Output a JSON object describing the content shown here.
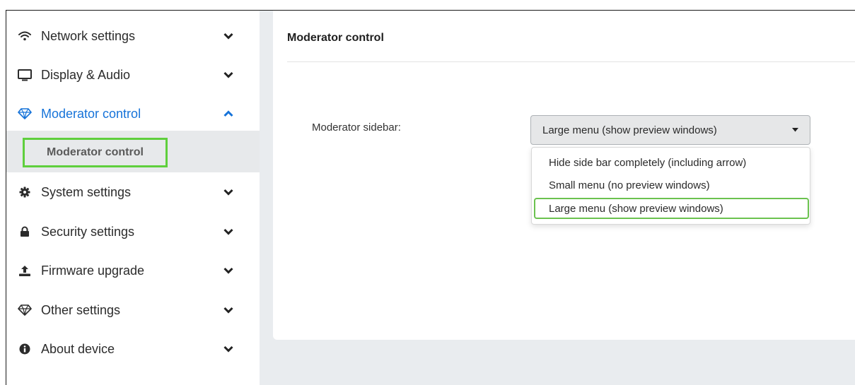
{
  "sidebar": {
    "items": [
      {
        "label": "Network settings",
        "icon": "wifi-icon",
        "expanded": false
      },
      {
        "label": "Display & Audio",
        "icon": "monitor-icon",
        "expanded": false
      },
      {
        "label": "Moderator control",
        "icon": "diamond-icon",
        "expanded": true
      },
      {
        "label": "System settings",
        "icon": "gear-icon",
        "expanded": false
      },
      {
        "label": "Security settings",
        "icon": "lock-icon",
        "expanded": false
      },
      {
        "label": "Firmware upgrade",
        "icon": "upload-icon",
        "expanded": false
      },
      {
        "label": "Other settings",
        "icon": "diamond-icon",
        "expanded": false
      },
      {
        "label": "About device",
        "icon": "info-icon",
        "expanded": false
      }
    ],
    "submenu": {
      "label": "Moderator control"
    }
  },
  "main": {
    "title": "Moderator control",
    "field_label": "Moderator sidebar:",
    "select_value": "Large menu (show preview windows)",
    "options": [
      "Hide side bar completely (including arrow)",
      "Small menu (no preview windows)",
      "Large menu (show preview windows)"
    ],
    "selected_index": 2
  },
  "colors": {
    "accent": "#1673d9",
    "highlight": "#5fcf3d",
    "background": "#e9ecef"
  }
}
